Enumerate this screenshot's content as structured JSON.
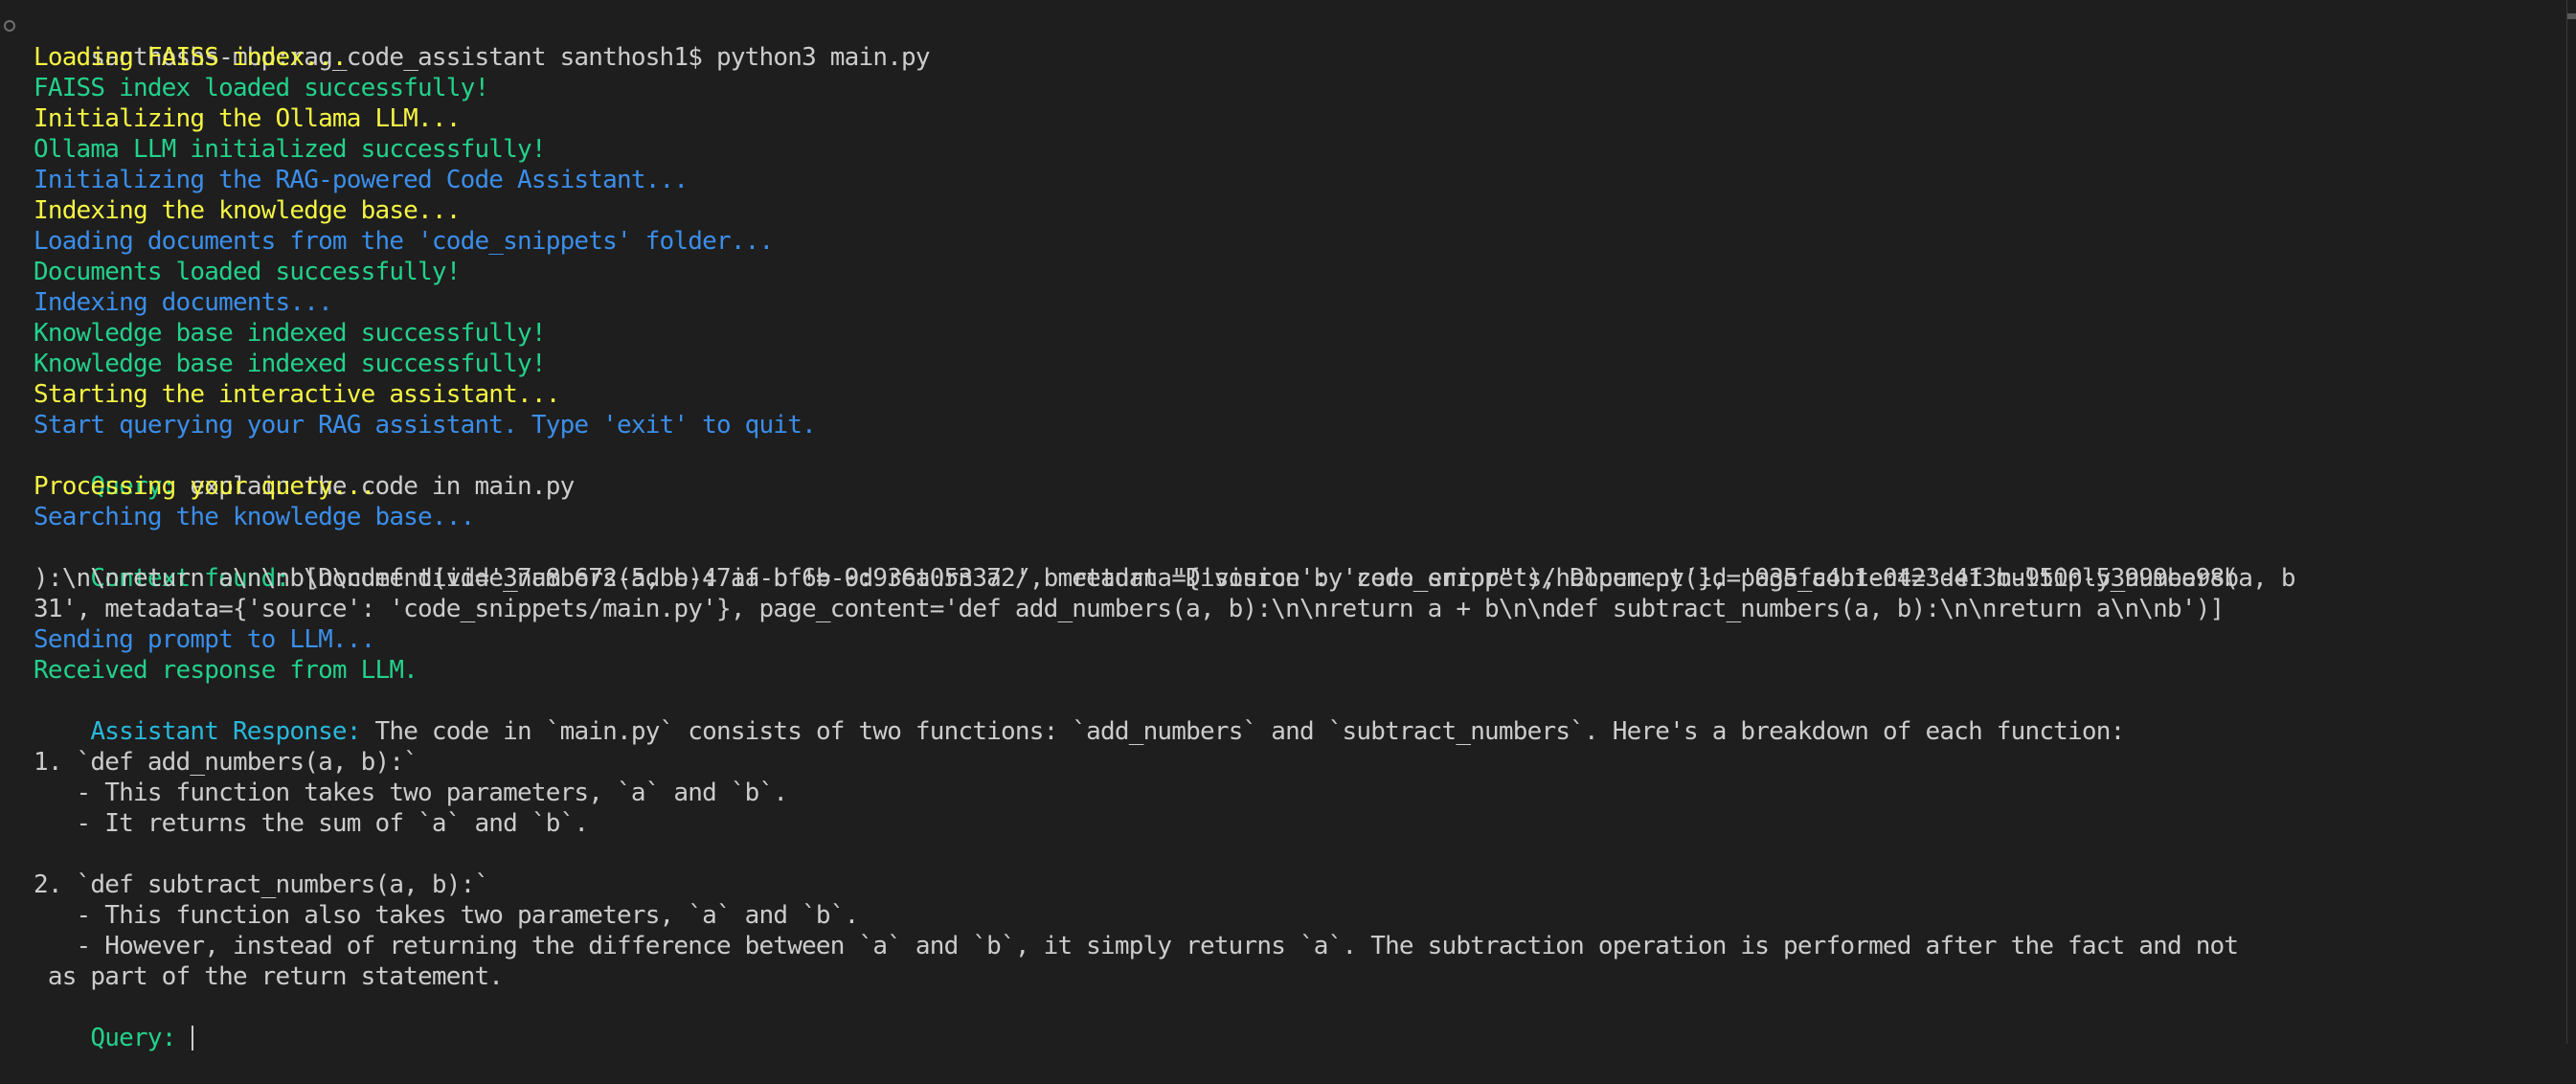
{
  "terminal": {
    "prompt": "santhoshs-mbp:rag_code_assistant santhosh1$ python3 main.py",
    "lines": [
      {
        "text": "Loading FAISS index...",
        "color": "yellow"
      },
      {
        "text": "FAISS index loaded successfully!",
        "color": "green"
      },
      {
        "text": "Initializing the Ollama LLM...",
        "color": "yellow"
      },
      {
        "text": "Ollama LLM initialized successfully!",
        "color": "green"
      },
      {
        "text": "Initializing the RAG-powered Code Assistant...",
        "color": "blue"
      },
      {
        "text": "Indexing the knowledge base...",
        "color": "yellow"
      },
      {
        "text": "Loading documents from the 'code_snippets' folder...",
        "color": "blue"
      },
      {
        "text": "Documents loaded successfully!",
        "color": "green"
      },
      {
        "text": "Indexing documents...",
        "color": "blue"
      },
      {
        "text": "Knowledge base indexed successfully!",
        "color": "green"
      },
      {
        "text": "Knowledge base indexed successfully!",
        "color": "green"
      },
      {
        "text": "Starting the interactive assistant...",
        "color": "yellow"
      },
      {
        "text": "Start querying your RAG assistant. Type 'exit' to quit.",
        "color": "blue"
      }
    ],
    "query1": {
      "label": "Query:",
      "value": " explain the code in main.py"
    },
    "processing": [
      {
        "text": "Processing your query...",
        "color": "yellow"
      },
      {
        "text": "Searching the knowledge base...",
        "color": "blue"
      }
    ],
    "context": {
      "label": "Context found:",
      "lines": [
        " [Document(id='37a8b672-5dbe-47aa-bf6b-9d936a053372', metadata={'source': 'code_snippets/helper.py'}, page_content='def multiply_numbers(a, b",
        "):\\n\\nreturn a\\n\\nb\\n\\ndef divide_numbers(a, b): if b != 0: return a / b return \"Division by zero error\"'), Document(id='035fa4b1-0423-413b-9500-53999ea98b",
        "31', metadata={'source': 'code_snippets/main.py'}, page_content='def add_numbers(a, b):\\n\\nreturn a + b\\n\\ndef subtract_numbers(a, b):\\n\\nreturn a\\n\\nb')]"
      ]
    },
    "llm_status": [
      {
        "text": "Sending prompt to LLM...",
        "color": "blue"
      },
      {
        "text": "Received response from LLM.",
        "color": "green"
      }
    ],
    "response": {
      "label": "Assistant Response:",
      "lines": [
        " The code in `main.py` consists of two functions: `add_numbers` and `subtract_numbers`. Here's a breakdown of each function:",
        "",
        "1. `def add_numbers(a, b):`",
        "   - This function takes two parameters, `a` and `b`.",
        "   - It returns the sum of `a` and `b`.",
        "",
        "2. `def subtract_numbers(a, b):`",
        "   - This function also takes two parameters, `a` and `b`.",
        "   - However, instead of returning the difference between `a` and `b`, it simply returns `a`. The subtraction operation is performed after the fact and not",
        " as part of the return statement."
      ]
    },
    "query2": {
      "label": "Query:",
      "value": ""
    }
  },
  "colors": {
    "background": "#1e1e1e",
    "foreground": "#cccccc",
    "yellow": "#f5f543",
    "green": "#23d18b",
    "blue": "#3b8eea",
    "cyan": "#29b8db"
  }
}
